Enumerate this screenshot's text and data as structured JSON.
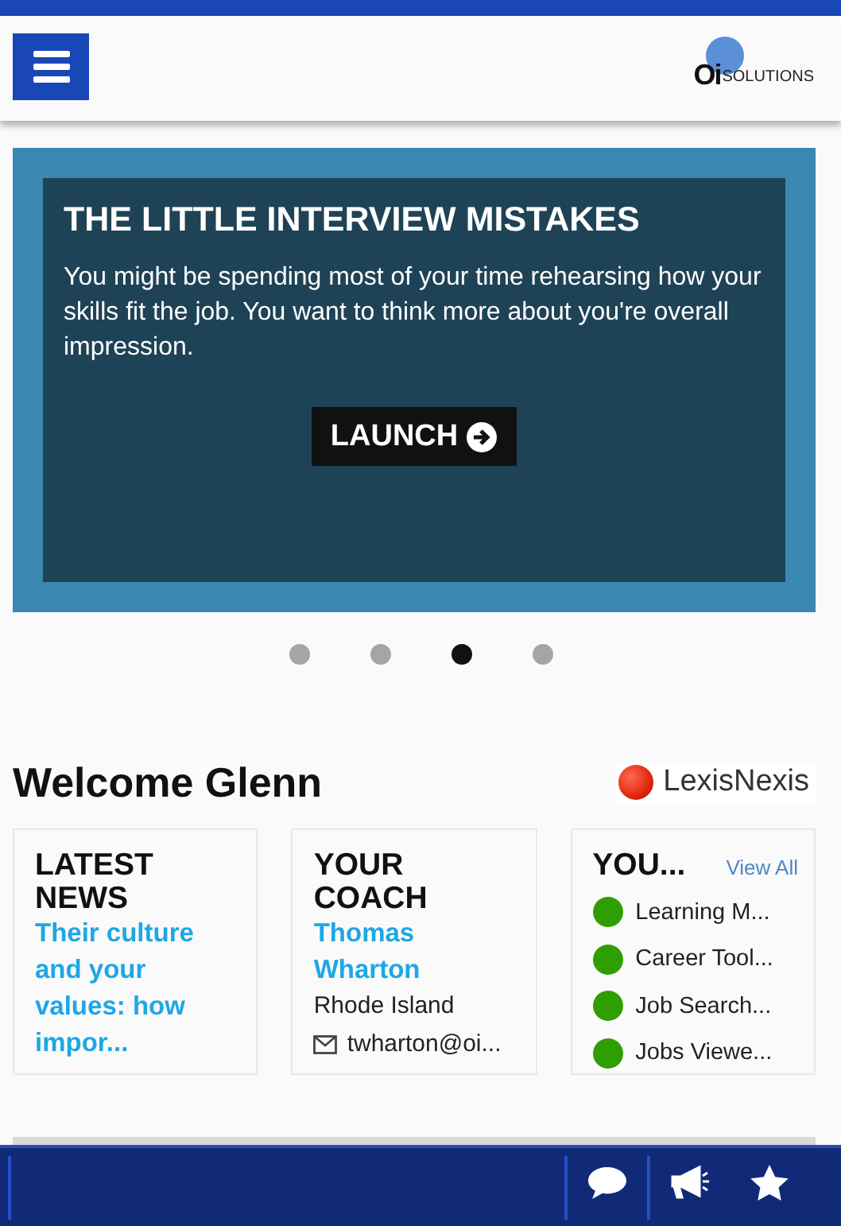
{
  "header": {
    "logo": {
      "mark": "Oi",
      "name": "SOLUTIONS"
    }
  },
  "carousel": {
    "title": "THE LITTLE INTERVIEW MISTAKES",
    "body": "You might be spending most of your time rehearsing how your skills fit the job. You want to think more about you're overall impression.",
    "button": "LAUNCH",
    "dots": [
      {
        "selected": false
      },
      {
        "selected": false
      },
      {
        "selected": true
      },
      {
        "selected": false
      }
    ]
  },
  "welcome": {
    "title": "Welcome Glenn",
    "partner_logo": "LexisNexis"
  },
  "cards": [
    {
      "kind": "news",
      "title": "LATEST NEWS",
      "headline": "Their culture and your values: how impor..."
    },
    {
      "kind": "coach",
      "title": "YOUR COACH",
      "name": "Thomas Wharton",
      "location": "Rhode Island",
      "email": "twharton@oi..."
    },
    {
      "kind": "list",
      "title": "YOU...",
      "link": "View All",
      "items": [
        "Learning M...",
        "Career Tool...",
        "Job Search...",
        "Jobs Viewe..."
      ]
    }
  ]
}
